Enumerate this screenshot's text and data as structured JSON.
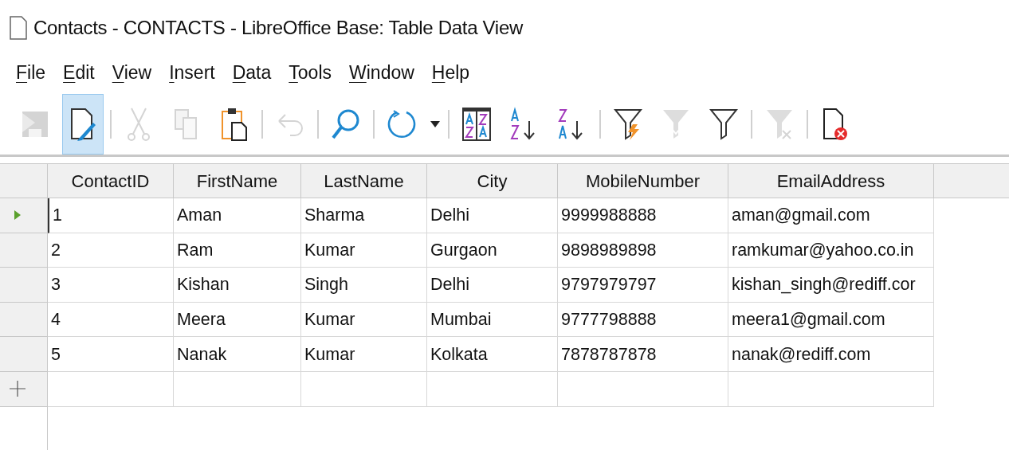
{
  "window": {
    "title": "Contacts - CONTACTS - LibreOffice Base: Table Data View"
  },
  "menu": [
    "File",
    "Edit",
    "View",
    "Insert",
    "Data",
    "Tools",
    "Window",
    "Help"
  ],
  "toolbar": [
    {
      "kind": "save",
      "disabled": true,
      "selected": false
    },
    {
      "kind": "edit",
      "disabled": false,
      "selected": true
    },
    {
      "kind": "separator"
    },
    {
      "kind": "cut",
      "disabled": true,
      "selected": false
    },
    {
      "kind": "copy",
      "disabled": true,
      "selected": false
    },
    {
      "kind": "paste",
      "disabled": false,
      "selected": false
    },
    {
      "kind": "separator"
    },
    {
      "kind": "undo",
      "disabled": true,
      "selected": false
    },
    {
      "kind": "separator"
    },
    {
      "kind": "find",
      "disabled": false,
      "selected": false
    },
    {
      "kind": "separator"
    },
    {
      "kind": "refresh",
      "disabled": false,
      "selected": false
    },
    {
      "kind": "dropdown",
      "disabled": false,
      "selected": false
    },
    {
      "kind": "separator"
    },
    {
      "kind": "sort",
      "disabled": false,
      "selected": false
    },
    {
      "kind": "sort-asc",
      "disabled": false,
      "selected": false
    },
    {
      "kind": "sort-desc",
      "disabled": false,
      "selected": false
    },
    {
      "kind": "separator"
    },
    {
      "kind": "autofilter",
      "disabled": false,
      "selected": false
    },
    {
      "kind": "apply-filter",
      "disabled": true,
      "selected": false
    },
    {
      "kind": "standard-filter",
      "disabled": false,
      "selected": false
    },
    {
      "kind": "separator"
    },
    {
      "kind": "reset-filter",
      "disabled": true,
      "selected": false
    },
    {
      "kind": "separator"
    },
    {
      "kind": "delete-record",
      "disabled": false,
      "selected": false
    }
  ],
  "table": {
    "columns": [
      "ContactID",
      "FirstName",
      "LastName",
      "City",
      "MobileNumber",
      "EmailAddress"
    ],
    "rows": [
      {
        "current": true,
        "cells": [
          "1",
          "Aman",
          "Sharma",
          "Delhi",
          "9999988888",
          "aman@gmail.com"
        ]
      },
      {
        "current": false,
        "cells": [
          "2",
          "Ram",
          "Kumar",
          "Gurgaon",
          "9898989898",
          "ramkumar@yahoo.co.in"
        ]
      },
      {
        "current": false,
        "cells": [
          "3",
          "Kishan",
          "Singh",
          "Delhi",
          "9797979797",
          "kishan_singh@rediff.cor"
        ]
      },
      {
        "current": false,
        "cells": [
          "4",
          "Meera",
          "Kumar",
          "Mumbai",
          "9777798888",
          "meera1@gmail.com"
        ]
      },
      {
        "current": false,
        "cells": [
          "5",
          "Nanak",
          "Kumar",
          "Kolkata",
          "7878787878",
          "nanak@rediff.com"
        ]
      }
    ]
  }
}
